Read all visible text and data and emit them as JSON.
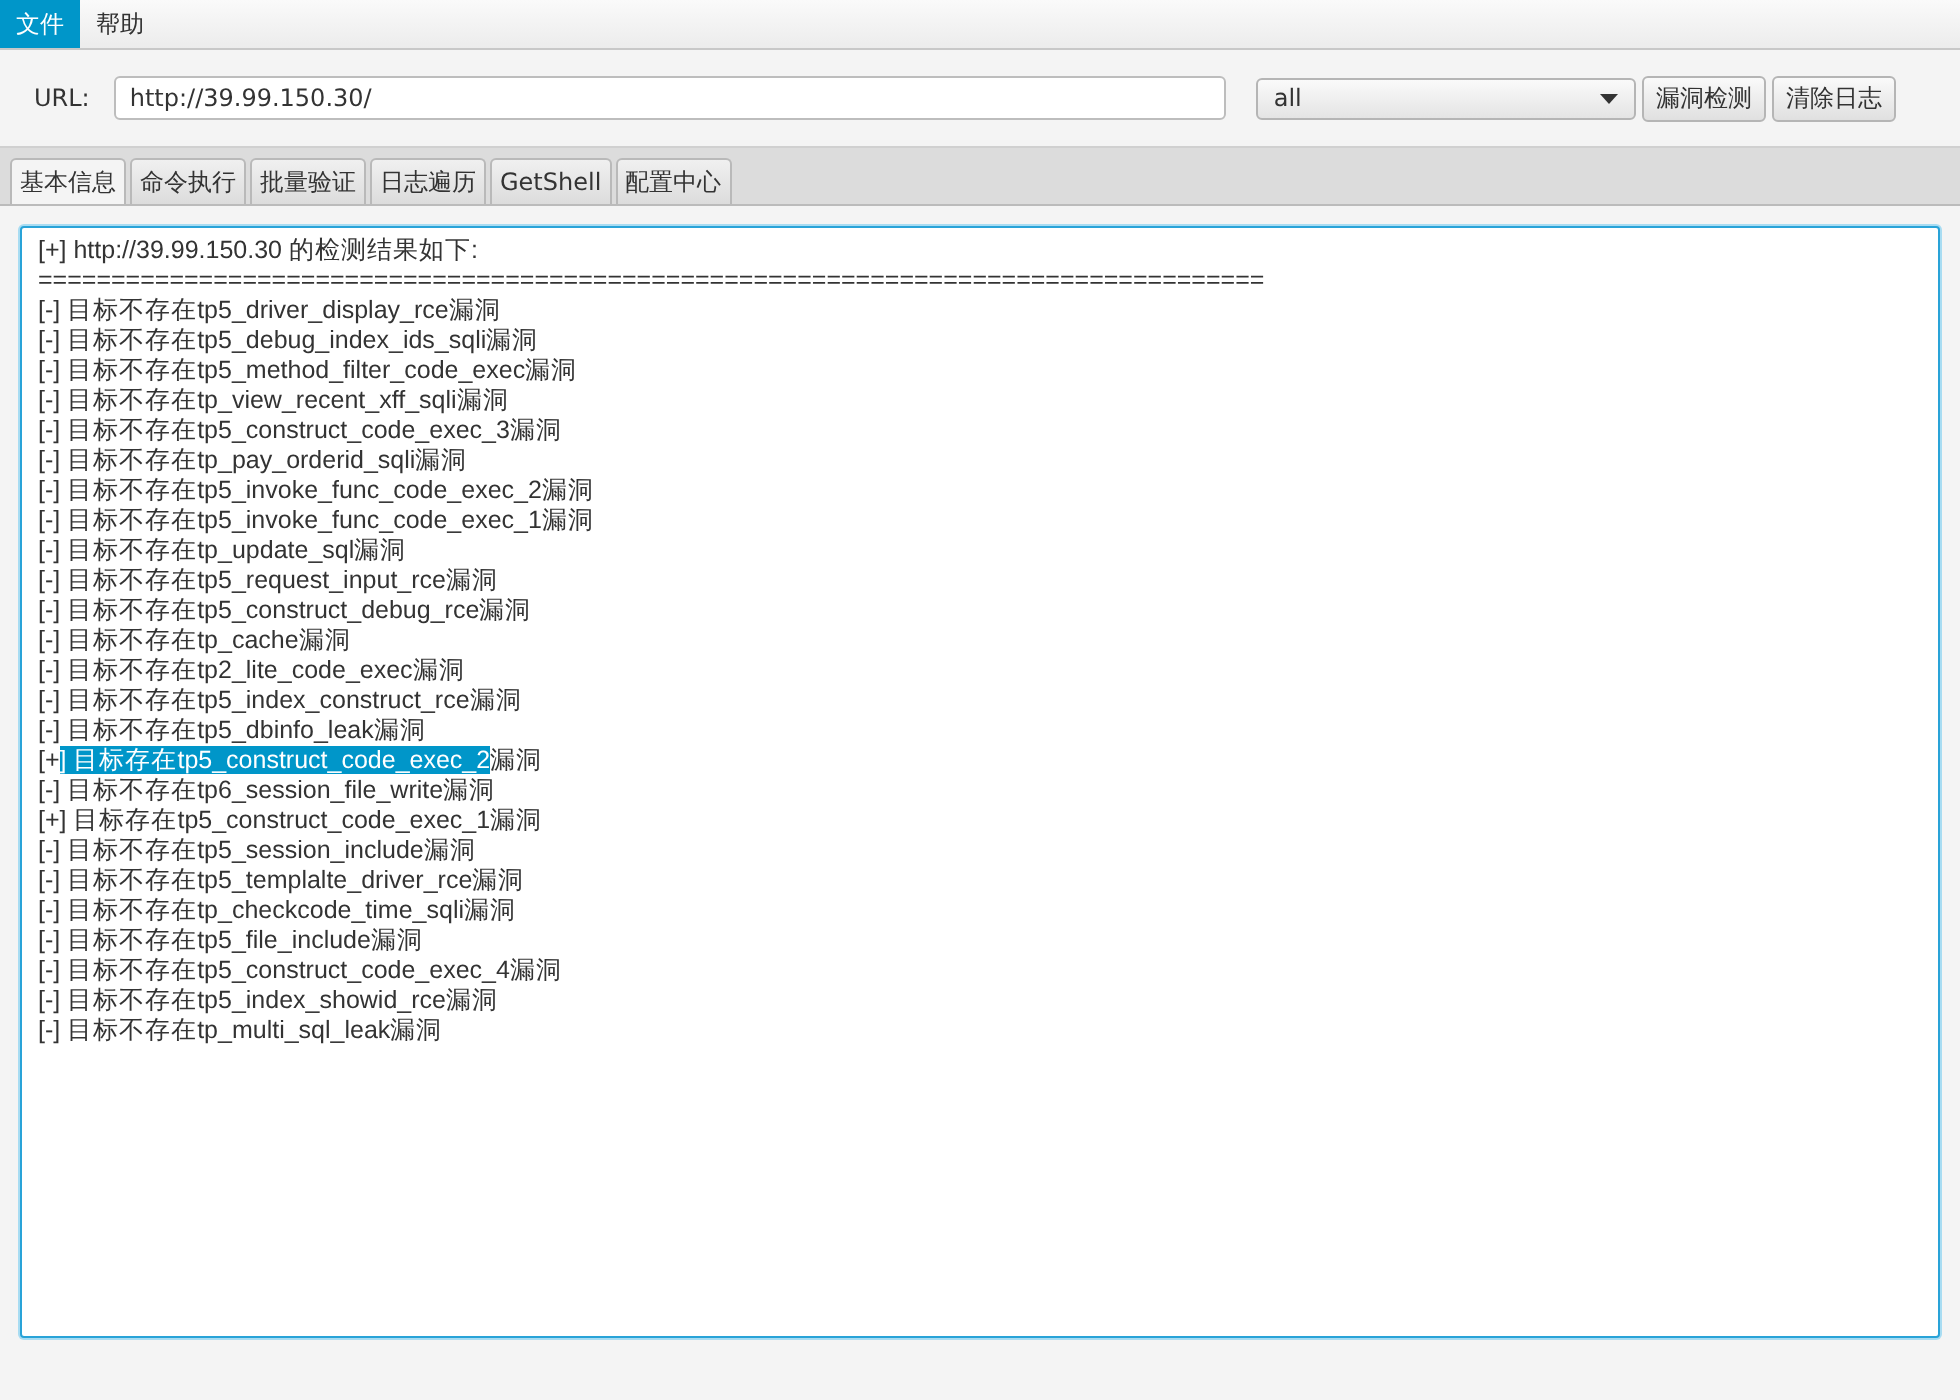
{
  "menu": [
    {
      "label": "文件",
      "selected": true
    },
    {
      "label": "帮助",
      "selected": false
    }
  ],
  "url_bar": {
    "label": "URL:",
    "value": "http://39.99.150.30/"
  },
  "dropdown": {
    "value": "all"
  },
  "buttons": [
    "漏洞检测",
    "清除日志"
  ],
  "tabs": [
    {
      "label": "基本信息",
      "selected": true
    },
    {
      "label": "命令执行",
      "selected": false
    },
    {
      "label": "批量验证",
      "selected": false
    },
    {
      "label": "日志遍历",
      "selected": false
    },
    {
      "label": "GetShell",
      "selected": false
    },
    {
      "label": "配置中心",
      "selected": false
    }
  ],
  "log": [
    {
      "segments": [
        {
          "text": "[+] http://39.99.150.30 的检测结果如下:",
          "selected": false
        }
      ]
    },
    {
      "segments": [
        {
          "text": "====================================================================================",
          "selected": false
        }
      ]
    },
    {
      "segments": [
        {
          "text": "[-] 目标不存在tp5_driver_display_rce漏洞",
          "selected": false
        }
      ]
    },
    {
      "segments": [
        {
          "text": "[-] 目标不存在tp5_debug_index_ids_sqli漏洞",
          "selected": false
        }
      ]
    },
    {
      "segments": [
        {
          "text": "[-] 目标不存在tp5_method_filter_code_exec漏洞",
          "selected": false
        }
      ]
    },
    {
      "segments": [
        {
          "text": "[-] 目标不存在tp_view_recent_xff_sqli漏洞",
          "selected": false
        }
      ]
    },
    {
      "segments": [
        {
          "text": "[-] 目标不存在tp5_construct_code_exec_3漏洞",
          "selected": false
        }
      ]
    },
    {
      "segments": [
        {
          "text": "[-] 目标不存在tp_pay_orderid_sqli漏洞",
          "selected": false
        }
      ]
    },
    {
      "segments": [
        {
          "text": "[-] 目标不存在tp5_invoke_func_code_exec_2漏洞",
          "selected": false
        }
      ]
    },
    {
      "segments": [
        {
          "text": "[-] 目标不存在tp5_invoke_func_code_exec_1漏洞",
          "selected": false
        }
      ]
    },
    {
      "segments": [
        {
          "text": "[-] 目标不存在tp_update_sql漏洞",
          "selected": false
        }
      ]
    },
    {
      "segments": [
        {
          "text": "[-] 目标不存在tp5_request_input_rce漏洞",
          "selected": false
        }
      ]
    },
    {
      "segments": [
        {
          "text": "[-] 目标不存在tp5_construct_debug_rce漏洞",
          "selected": false
        }
      ]
    },
    {
      "segments": [
        {
          "text": "[-] 目标不存在tp_cache漏洞",
          "selected": false
        }
      ]
    },
    {
      "segments": [
        {
          "text": "[-] 目标不存在tp2_lite_code_exec漏洞",
          "selected": false
        }
      ]
    },
    {
      "segments": [
        {
          "text": "[-] 目标不存在tp5_index_construct_rce漏洞",
          "selected": false
        }
      ]
    },
    {
      "segments": [
        {
          "text": "[-] 目标不存在tp5_dbinfo_leak漏洞",
          "selected": false
        }
      ]
    },
    {
      "segments": [
        {
          "text": "[+",
          "selected": false
        },
        {
          "text": "] 目标存在tp5_construct_code_exec_2",
          "selected": true
        },
        {
          "text": "漏洞",
          "selected": false
        }
      ]
    },
    {
      "segments": [
        {
          "text": "[-] 目标不存在tp6_session_file_write漏洞",
          "selected": false
        }
      ]
    },
    {
      "segments": [
        {
          "text": "[+] 目标存在tp5_construct_code_exec_1漏洞",
          "selected": false
        }
      ]
    },
    {
      "segments": [
        {
          "text": "[-] 目标不存在tp5_session_include漏洞",
          "selected": false
        }
      ]
    },
    {
      "segments": [
        {
          "text": "[-] 目标不存在tp5_templalte_driver_rce漏洞",
          "selected": false
        }
      ]
    },
    {
      "segments": [
        {
          "text": "[-] 目标不存在tp_checkcode_time_sqli漏洞",
          "selected": false
        }
      ]
    },
    {
      "segments": [
        {
          "text": "[-] 目标不存在tp5_file_include漏洞",
          "selected": false
        }
      ]
    },
    {
      "segments": [
        {
          "text": "[-] 目标不存在tp5_construct_code_exec_4漏洞",
          "selected": false
        }
      ]
    },
    {
      "segments": [
        {
          "text": "[-] 目标不存在tp5_index_showid_rce漏洞",
          "selected": false
        }
      ]
    },
    {
      "segments": [
        {
          "text": "[-] 目标不存在tp_multi_sql_leak漏洞",
          "selected": false
        }
      ]
    }
  ]
}
